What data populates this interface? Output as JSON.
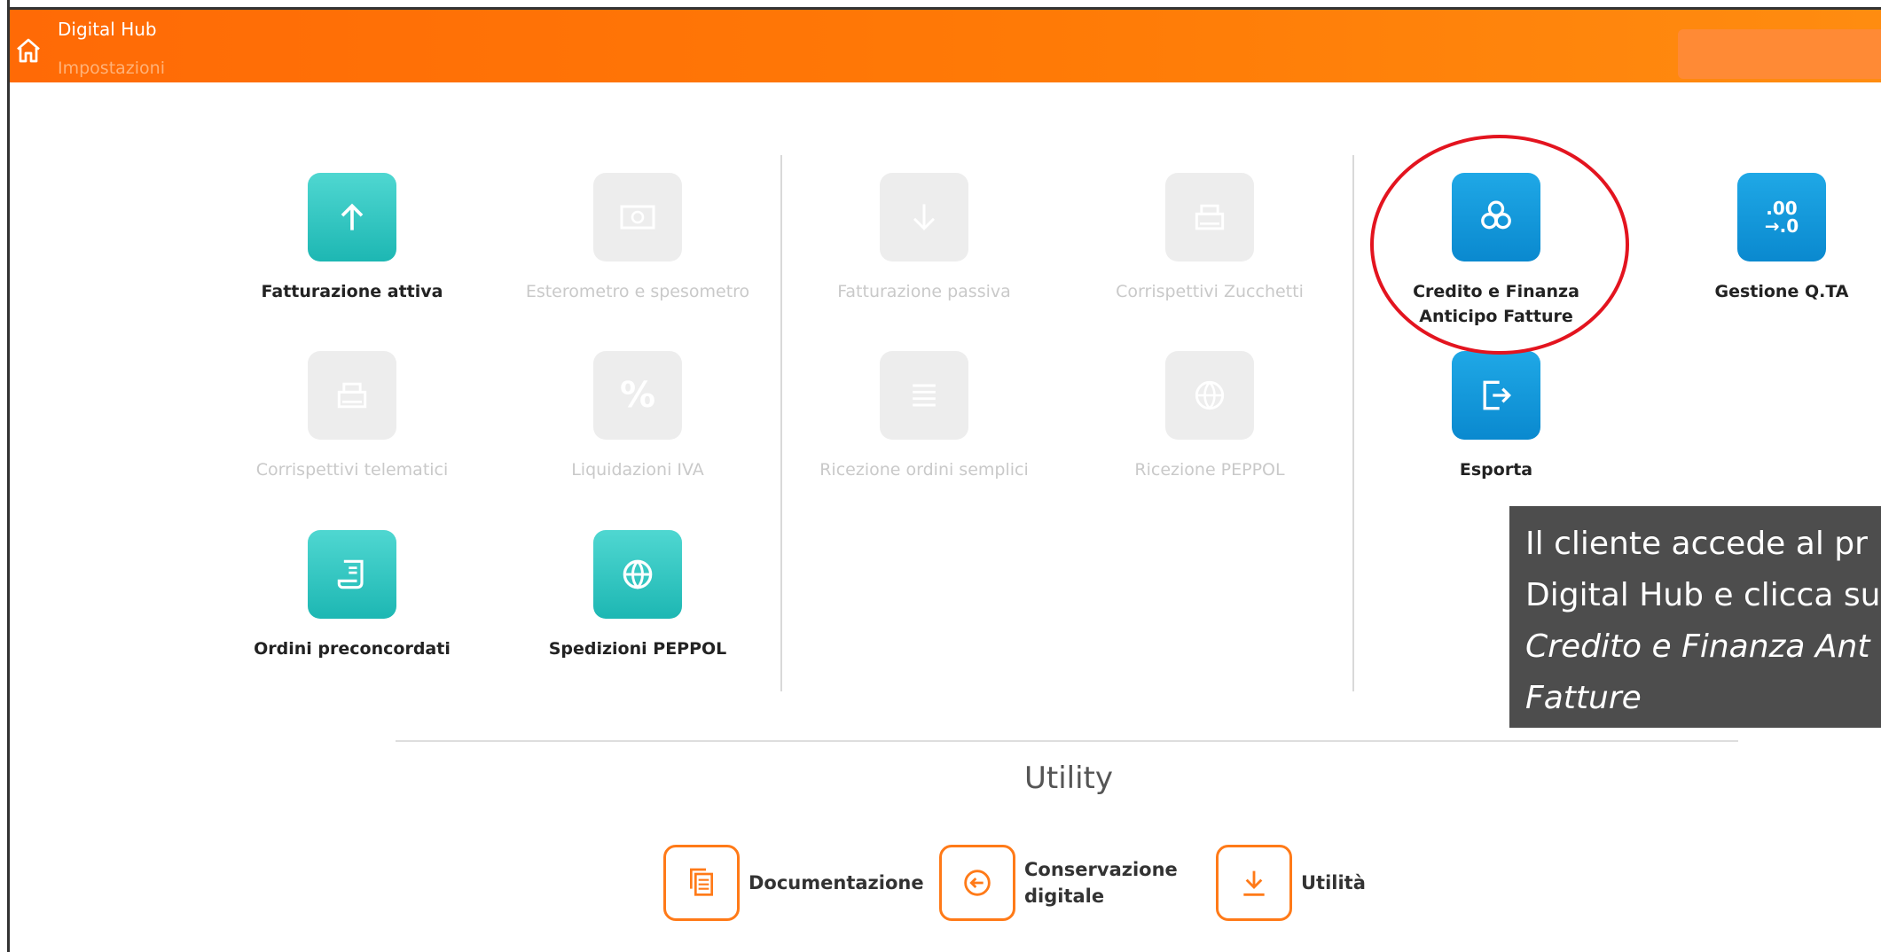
{
  "header": {
    "title": "Digital Hub",
    "subtitle": "Impostazioni"
  },
  "tiles": [
    {
      "label": "Fatturazione attiva",
      "enabled": true,
      "icon": "arrow-up-icon"
    },
    {
      "label": "Esterometro e spesometro",
      "enabled": false,
      "icon": "globe-card-icon"
    },
    {
      "label": "Fatturazione passiva",
      "enabled": false,
      "icon": "arrow-down-icon"
    },
    {
      "label": "Corrispettivi Zucchetti",
      "enabled": false,
      "icon": "register-icon"
    },
    {
      "label": "Credito e Finanza Anticipo Fatture",
      "label_line1": "Credito e Finanza",
      "label_line2": "Anticipo Fatture",
      "enabled": true,
      "icon": "infinity-flower-icon"
    },
    {
      "label": "Gestione Q.TA",
      "enabled": true,
      "icon": "decimal-icon",
      "icon_text_top": ".00",
      "icon_text_bottom": "→.0"
    },
    {
      "label": "Corrispettivi telematici",
      "enabled": false,
      "icon": "register-icon"
    },
    {
      "label": "Liquidazioni IVA",
      "enabled": false,
      "icon": "percent-icon"
    },
    {
      "label": "Ricezione ordini semplici",
      "enabled": false,
      "icon": "list-icon"
    },
    {
      "label": "Ricezione PEPPOL",
      "enabled": false,
      "icon": "globe-icon"
    },
    {
      "label": "Esporta",
      "enabled": true,
      "icon": "export-icon"
    },
    {
      "label": "Ordini preconcordati",
      "enabled": true,
      "icon": "document-icon"
    },
    {
      "label": "Spedizioni PEPPOL",
      "enabled": true,
      "icon": "globe-icon"
    }
  ],
  "tooltip": {
    "line1": "Il cliente accede al pr",
    "line2": "Digital Hub e clicca su",
    "line3": "Credito e Finanza Ant",
    "line4": "Fatture"
  },
  "utility": {
    "title": "Utility",
    "items": [
      {
        "label": "Documentazione",
        "icon": "documents-icon"
      },
      {
        "label_line1": "Conservazione",
        "label_line2": "digitale",
        "icon": "arrow-left-circle-icon"
      },
      {
        "label": "Utilità",
        "icon": "download-icon"
      }
    ]
  },
  "colors": {
    "header_orange": "#ff6a06",
    "teal": "#1db7b3",
    "blue": "#0a89cf",
    "highlight_red": "#e3141f",
    "utility_orange": "#ff7a18"
  }
}
